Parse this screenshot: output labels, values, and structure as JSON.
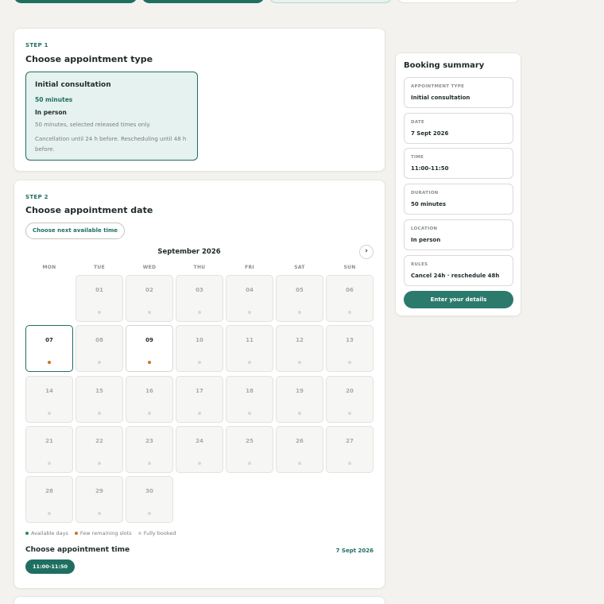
{
  "step1": {
    "label": "STEP 1",
    "title": "Choose appointment type",
    "option": {
      "name": "Initial consultation",
      "duration": "50 minutes",
      "location": "In person",
      "description": "50 minutes, selected released times only.",
      "rules": "Cancellation until 24 h before. Rescheduling until 48 h before."
    }
  },
  "step2": {
    "label": "STEP 2",
    "title": "Choose appointment date",
    "next_available": "Choose next available time",
    "month": "September 2026",
    "next_month_glyph": "›",
    "weekdays": [
      "MON",
      "TUE",
      "WED",
      "THU",
      "FRI",
      "SAT",
      "SUN"
    ],
    "days": [
      {
        "n": "01",
        "status": "booked"
      },
      {
        "n": "02",
        "status": "booked"
      },
      {
        "n": "03",
        "status": "booked"
      },
      {
        "n": "04",
        "status": "booked"
      },
      {
        "n": "05",
        "status": "booked"
      },
      {
        "n": "06",
        "status": "booked"
      },
      {
        "n": "07",
        "status": "few",
        "selected": true
      },
      {
        "n": "08",
        "status": "booked"
      },
      {
        "n": "09",
        "status": "few"
      },
      {
        "n": "10",
        "status": "booked"
      },
      {
        "n": "11",
        "status": "booked"
      },
      {
        "n": "12",
        "status": "booked"
      },
      {
        "n": "13",
        "status": "booked"
      },
      {
        "n": "14",
        "status": "booked"
      },
      {
        "n": "15",
        "status": "booked"
      },
      {
        "n": "16",
        "status": "booked"
      },
      {
        "n": "17",
        "status": "booked"
      },
      {
        "n": "18",
        "status": "booked"
      },
      {
        "n": "19",
        "status": "booked"
      },
      {
        "n": "20",
        "status": "booked"
      },
      {
        "n": "21",
        "status": "booked"
      },
      {
        "n": "22",
        "status": "booked"
      },
      {
        "n": "23",
        "status": "booked"
      },
      {
        "n": "24",
        "status": "booked"
      },
      {
        "n": "25",
        "status": "booked"
      },
      {
        "n": "26",
        "status": "booked"
      },
      {
        "n": "27",
        "status": "booked"
      },
      {
        "n": "28",
        "status": "booked"
      },
      {
        "n": "29",
        "status": "booked"
      },
      {
        "n": "30",
        "status": "booked"
      }
    ],
    "legend": {
      "available": "Available days",
      "few": "Few remaining slots",
      "booked": "Fully booked"
    },
    "legend_colors": {
      "available": "#2f8a4e",
      "few": "#c8771e",
      "booked": "#d3d2cf"
    },
    "time_title": "Choose appointment time",
    "time_date": "7 Sept 2026",
    "time_slot": "11:00-11:50"
  },
  "summary": {
    "title": "Booking summary",
    "fields": [
      {
        "label": "APPOINTMENT TYPE",
        "value": "Initial consultation"
      },
      {
        "label": "DATE",
        "value": "7 Sept 2026"
      },
      {
        "label": "TIME",
        "value": "11:00-11:50"
      },
      {
        "label": "DURATION",
        "value": "50 minutes"
      },
      {
        "label": "LOCATION",
        "value": "In person"
      },
      {
        "label": "RULES",
        "value": "Cancel 24h · reschedule 48h"
      }
    ],
    "cta": "Enter your details"
  },
  "colors": {
    "accent": "#1f6f61",
    "accent_light": "#e6f2ef",
    "background": "#f3f2ee"
  }
}
